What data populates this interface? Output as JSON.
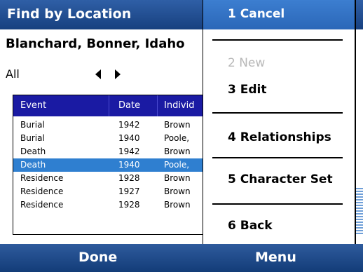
{
  "window": {
    "title": "Find by Location"
  },
  "location": "Blanchard, Bonner, Idaho",
  "filter": {
    "value": "All",
    "prev_icon": "triangle-left",
    "next_icon": "triangle-right"
  },
  "table": {
    "columns": [
      "Event",
      "Date",
      "Individ"
    ],
    "rows": [
      {
        "event": "Burial",
        "date": "1942",
        "individual": "Brown"
      },
      {
        "event": "Burial",
        "date": "1940",
        "individual": "Poole,"
      },
      {
        "event": "Death",
        "date": "1942",
        "individual": "Brown"
      },
      {
        "event": "Death",
        "date": "1940",
        "individual": "Poole,",
        "selected": true
      },
      {
        "event": "Residence",
        "date": "1928",
        "individual": "Brown"
      },
      {
        "event": "Residence",
        "date": "1927",
        "individual": "Brown"
      },
      {
        "event": "Residence",
        "date": "1928",
        "individual": "Brown"
      }
    ]
  },
  "menu": {
    "items": [
      {
        "label": "1 Cancel",
        "state": "selected"
      },
      {
        "label": "2 New",
        "state": "disabled"
      },
      {
        "label": "3 Edit",
        "state": "enabled"
      },
      {
        "label": "4 Relationships",
        "state": "enabled"
      },
      {
        "label": "5 Character Set",
        "state": "enabled"
      },
      {
        "label": "6 Back",
        "state": "enabled"
      }
    ]
  },
  "softkeys": {
    "left": "Done",
    "right": "Menu"
  },
  "colors": {
    "titlebar": "#17407f",
    "selection": "#2f7fd0",
    "header": "#1a1aa3"
  }
}
